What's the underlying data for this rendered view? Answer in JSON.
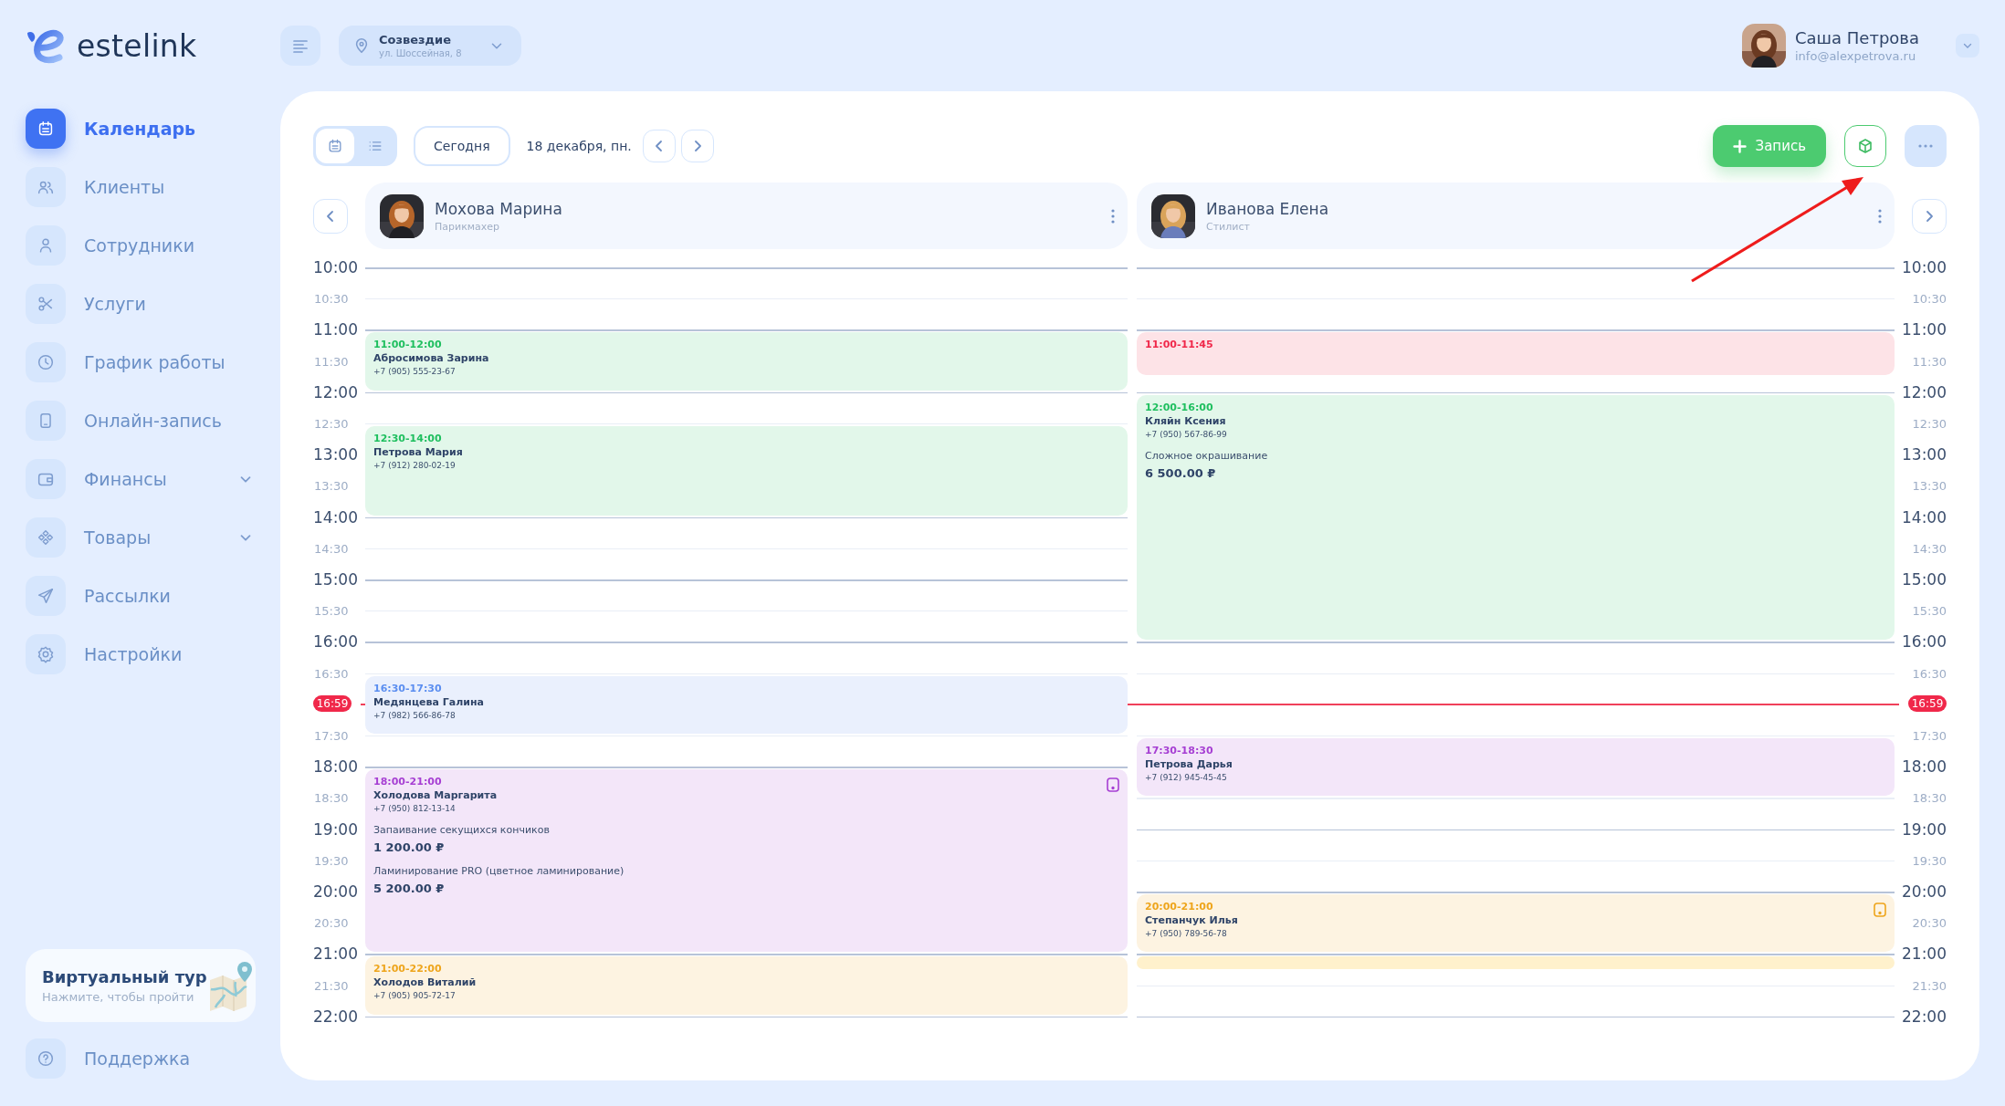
{
  "logo": {
    "text": "estelink"
  },
  "sidebar": {
    "items": [
      {
        "label": "Календарь",
        "selected": true
      },
      {
        "label": "Клиенты",
        "selected": false
      },
      {
        "label": "Сотрудники",
        "selected": false
      },
      {
        "label": "Услуги",
        "selected": false
      },
      {
        "label": "График работы",
        "selected": false
      },
      {
        "label": "Онлайн-запись",
        "selected": false
      },
      {
        "label": "Финансы",
        "selected": false,
        "expanded": false
      },
      {
        "label": "Товары",
        "selected": false,
        "expanded": false
      },
      {
        "label": "Рассылки",
        "selected": false
      },
      {
        "label": "Настройки",
        "selected": false
      }
    ]
  },
  "tour_card": {
    "title": "Виртуальный тур",
    "subtitle": "Нажмите, чтобы пройти"
  },
  "support": {
    "label": "Поддержка"
  },
  "topbar": {
    "location": {
      "name": "Созвездие",
      "address": "ул. Шоссейная, 8"
    },
    "user": {
      "name": "Саша Петрова",
      "email": "info@alexpetrova.ru"
    }
  },
  "toolbar": {
    "views": [
      {
        "selected": true
      },
      {
        "selected": false
      }
    ],
    "today_button": "Сегодня",
    "date": "18 декабря, пн.",
    "add_button": "Запись"
  },
  "time_labels_left": [
    "10:00",
    "10:30",
    "11:00",
    "11:30",
    "12:00",
    "12:30",
    "13:00",
    "13:30",
    "14:00",
    "14:30",
    "15:00",
    "15:30",
    "16:00",
    "16:30",
    "17:30",
    "18:00",
    "18:30",
    "19:00",
    "19:30",
    "20:00",
    "20:30",
    "21:00",
    "21:30",
    "22:00"
  ],
  "time_labels_right": [
    "10:00",
    "10:30",
    "11:00",
    "11:30",
    "12:00",
    "12:30",
    "13:00",
    "13:30",
    "14:00",
    "14:30",
    "15:00",
    "15:30",
    "16:00",
    "16:30",
    "17:30",
    "18:00",
    "18:30",
    "19:00",
    "19:30",
    "20:00",
    "20:30",
    "21:00",
    "21:30",
    "22:00"
  ],
  "now_marker": {
    "left": "16:59",
    "right": "16:59"
  },
  "staff": [
    {
      "name": "Мохова Марина",
      "role": "Парикмахер",
      "events": [
        {
          "time": "11:00-12:00",
          "client": "Абросимова Зарина",
          "phone": "+7 (905) 555-23-67",
          "color": "#1fbf5f",
          "online": false
        },
        {
          "time": "12:30-14:00",
          "client": "Петрова Мария",
          "phone": "+7 (912) 280-02-19",
          "color": "#1fbf5f",
          "online": false
        },
        {
          "time": "16:30-17:30",
          "client": "Медянцева Галина",
          "phone": "+7 (982) 566-86-78",
          "color": "#5b8ef0",
          "online": false
        },
        {
          "time": "18:00-21:00",
          "client": "Холодова Маргарита",
          "phone": "+7 (950) 812-13-14",
          "color": "#a63fd3",
          "online": true,
          "services": [
            {
              "name": "Запаивание секущихся кончиков",
              "price": "1 200.00 ₽"
            },
            {
              "name": "Ламинирование PRO (цветное ламинирование)",
              "price": "5 200.00 ₽"
            }
          ]
        },
        {
          "time": "21:00-22:00",
          "client": "Холодов Виталий",
          "phone": "+7 (905) 905-72-17",
          "color": "#eea51c",
          "online": false
        }
      ]
    },
    {
      "name": "Иванова Елена",
      "role": "Стилист",
      "events": [
        {
          "time": "11:00-11:45",
          "color": "#f0284a",
          "online": false
        },
        {
          "time": "12:00-16:00",
          "client": "Кляйн Ксения",
          "phone": "+7 (950) 567-86-99",
          "color": "#1fbf5f",
          "online": false,
          "services": [
            {
              "name": "Сложное окрашивание",
              "price": "6 500.00 ₽"
            }
          ]
        },
        {
          "time": "17:30-18:30",
          "client": "Петрова Дарья",
          "phone": "+7 (912) 945-45-45",
          "color": "#a63fd3",
          "online": false
        },
        {
          "time": "20:00-21:00",
          "client": "Степанчук Илья",
          "phone": "+7 (950) 789-56-78",
          "color": "#eea51c",
          "online": true
        },
        {
          "color": "#fff1cc",
          "online": false
        }
      ]
    }
  ]
}
